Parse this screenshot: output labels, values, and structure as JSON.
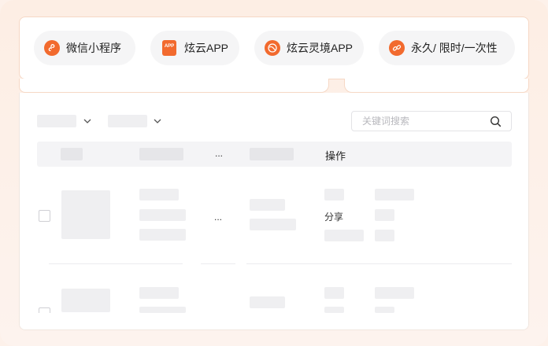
{
  "features": [
    {
      "label": "微信小程序",
      "icon": "mini-program-icon"
    },
    {
      "label": "炫云APP",
      "icon": "app-icon",
      "icon_text": "APP"
    },
    {
      "label": "炫云灵境APP",
      "icon": "lingjing-app-icon"
    },
    {
      "label": "永久/ 限时/一次性",
      "icon": "link-icon"
    }
  ],
  "toolbar": {
    "search_placeholder": "关键词搜索"
  },
  "table": {
    "header_ellipsis": "...",
    "header_action": "操作",
    "row1_ellipsis": "...",
    "row1_action": "分享"
  },
  "colors": {
    "accent": "#f26a2e",
    "border": "#f6d8c5",
    "skeleton": "#efeff1"
  }
}
